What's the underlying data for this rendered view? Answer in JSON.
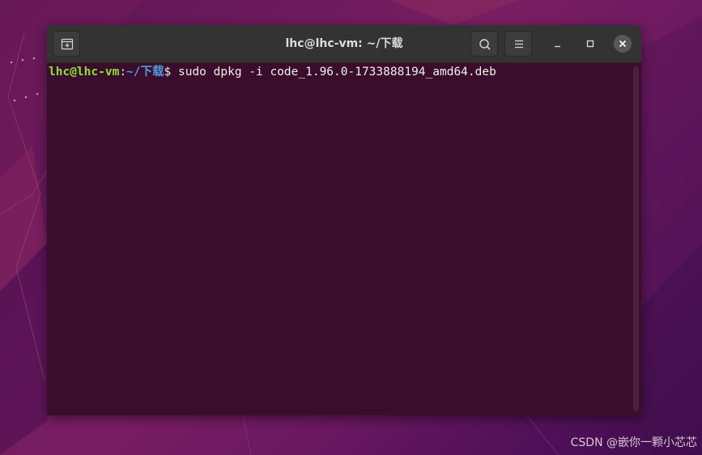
{
  "window": {
    "title": "lhc@lhc-vm: ~/下载"
  },
  "icons": {
    "new_tab": "new-tab-icon",
    "search": "search-icon",
    "menu": "hamburger-menu-icon",
    "minimize": "minimize-icon",
    "maximize": "maximize-icon",
    "close": "close-icon"
  },
  "terminal": {
    "prompt_user": "lhc@lhc-vm",
    "prompt_colon": ":",
    "prompt_path": "~/下载",
    "prompt_symbol": "$ ",
    "command": "sudo dpkg -i code_1.96.0-1733888194_amd64.deb"
  },
  "colors": {
    "terminal_bg": "#3b0d2c",
    "prompt_user": "#8ae234",
    "prompt_path": "#4f9be0",
    "titlebar_bg": "#333333"
  },
  "watermark": "CSDN @嵌你一颗小芯芯"
}
